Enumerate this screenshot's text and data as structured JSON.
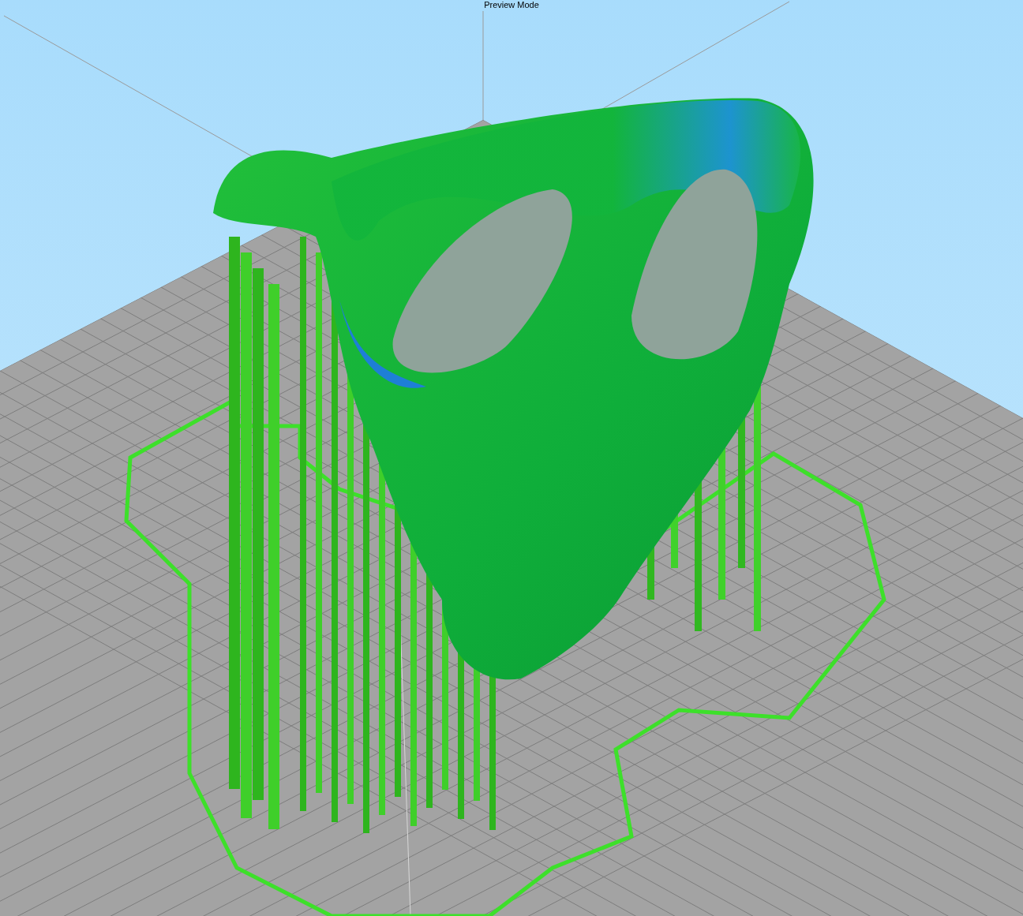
{
  "viewport": {
    "mode_label": "Preview Mode"
  }
}
